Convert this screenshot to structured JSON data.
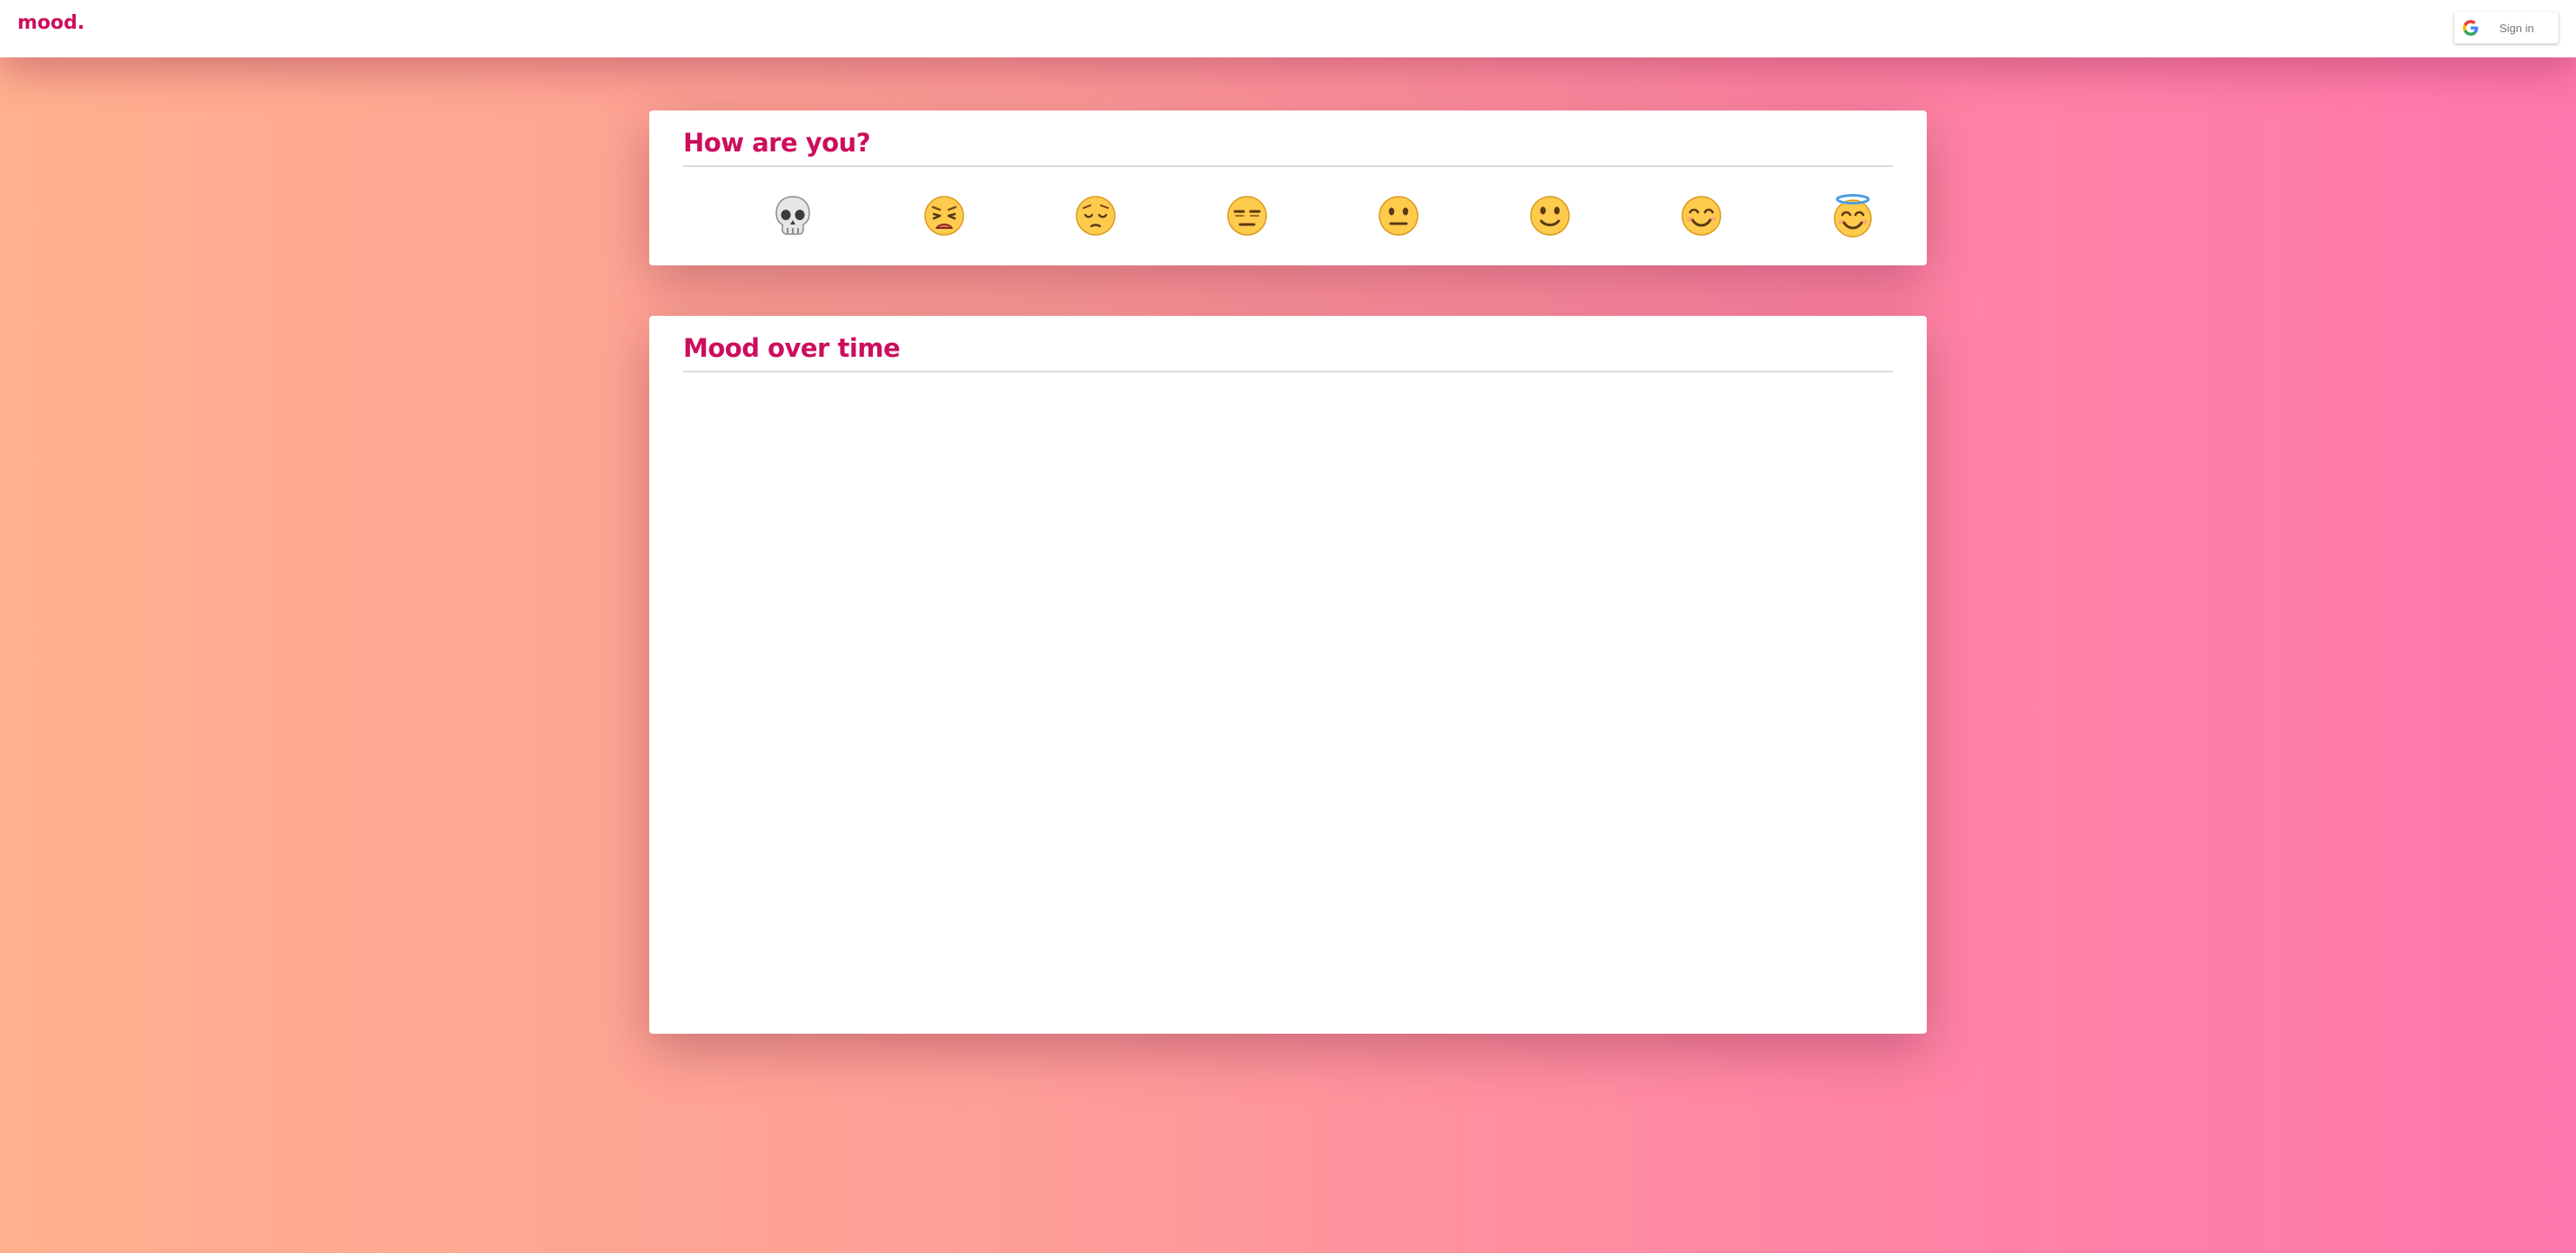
{
  "app": {
    "logo": "mood."
  },
  "auth": {
    "signin_label": "Sign in",
    "provider_icon": "google-icon"
  },
  "mood_card": {
    "title": "How are you?",
    "options": [
      {
        "name": "skull",
        "icon": "skull-icon"
      },
      {
        "name": "weary",
        "icon": "weary-face-icon"
      },
      {
        "name": "pensive",
        "icon": "pensive-face-icon"
      },
      {
        "name": "expressionless",
        "icon": "expressionless-face-icon"
      },
      {
        "name": "neutral",
        "icon": "neutral-face-icon"
      },
      {
        "name": "slight-smile",
        "icon": "slightly-smiling-face-icon"
      },
      {
        "name": "smile",
        "icon": "smiling-face-icon"
      },
      {
        "name": "halo",
        "icon": "smiling-face-with-halo-icon"
      }
    ]
  },
  "chart_card": {
    "title": "Mood over time"
  },
  "colors": {
    "accent": "#cc0e5c",
    "background_start": "#ffb08e",
    "background_end": "#ff78ad",
    "emoji_yellow": "#ffcb4c",
    "emoji_outline": "#d99a1e",
    "halo": "#4f9de0"
  }
}
